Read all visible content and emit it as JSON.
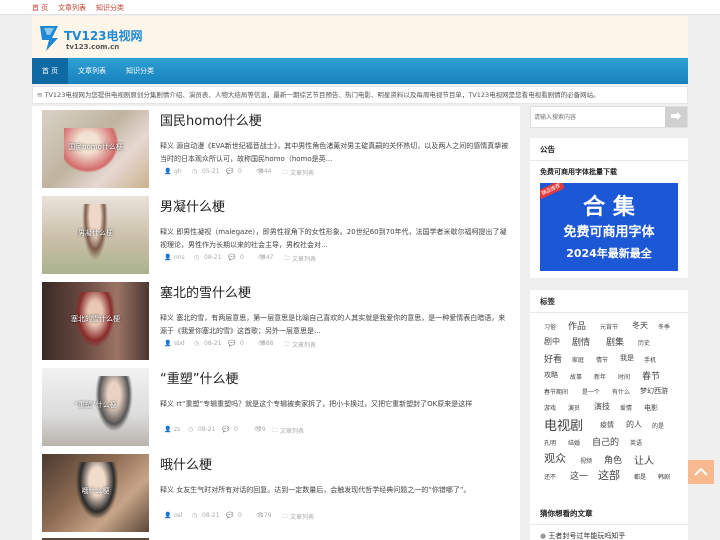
{
  "topnav": [
    "首 页",
    "文章列表",
    "知识分类"
  ],
  "logo": {
    "name": "TV123电视网",
    "domain": "tv123.com.cn"
  },
  "nav": [
    "首 页",
    "文章列表",
    "知识分类"
  ],
  "notice": "TV123电视网为您提供电视剧原创分集剧情介绍、演员表、人物大结局等信息，最新一期综艺节目预告、热门电影、明星资料以及每周电视节目单，TV123电视网是您看电视看剧情的必备网站。",
  "posts": [
    {
      "thumb_caption": "国民homo什么梗",
      "title": "国民homo什么梗",
      "excerpt": "释义 源自动漫《EVA新世纪福音战士》，其中男性角色渚薰对男主碇真嗣的关怀热切，以及两人之间的感情真挚被当时的日本观众所认可，故称国民homo（homo是英...",
      "author": "gh",
      "date": "05-21",
      "comments": "0",
      "views": "844",
      "category": "文章列表"
    },
    {
      "thumb_caption": "男凝什么梗",
      "title": "男凝什么梗",
      "excerpt": "释义 即男性凝视（malegaze），即男性视角下的女性形象。20世纪60到70年代，法国学者米歇尔福柯提出了凝视理论，男性作为长期以来的社会主导，男权社会对...",
      "author": "nns",
      "date": "08-21",
      "comments": "0",
      "views": "447",
      "category": "文章列表"
    },
    {
      "thumb_caption": "塞北的雪什么梗",
      "title": "塞北的雪什么梗",
      "excerpt": "释义 塞北的雪，有两层意思，第一层意思是比喻自己喜欢的人其实就是我爱你的意思，是一种爱情表白暗语，来源于《我爱你塞北的雪》这首歌；另外一层意思是...",
      "author": "sbd",
      "date": "08-21",
      "comments": "0",
      "views": "888",
      "category": "文章列表"
    },
    {
      "thumb_caption": "“重塑”什么梗",
      "title": "“重塑”什么梗",
      "excerpt": "释义 rt“重塑”专辑重塑吗？就是这个专辑被卖家拆了，把小卡换过，又把它重新塑封了OK原来是这样",
      "author": "zs",
      "date": "08-21",
      "comments": "0",
      "views": "79",
      "category": "文章列表"
    },
    {
      "thumb_caption": "哦什么梗",
      "title": "哦什么梗",
      "excerpt": "释义 女友生气时对所有对话的回复。达到一定数量后，会触发现代哲学经典问题之一的“你错哪了”。",
      "author": "osl",
      "date": "08-21",
      "comments": "0",
      "views": "179",
      "category": "文章列表"
    }
  ],
  "sidebar": {
    "search_placeholder": "请输入搜索内容",
    "notice_title": "公告",
    "ad_title": "免费可商用字体批量下载",
    "ad_line1": "合 集",
    "ad_line2": "免费可商用字体",
    "ad_line3": "2024年最新最全",
    "ad_badge": "精品推荐",
    "tags_title": "标签",
    "tags": [
      "习俗",
      "作品",
      "元宵节",
      "冬天",
      "冬季",
      "剧中",
      "剧情",
      "剧集",
      "历史",
      "好看",
      "家庭",
      "情节",
      "我是",
      "手机",
      "攻略",
      "故事",
      "新年",
      "时间",
      "春节",
      "春节期间",
      "是一个",
      "有什么",
      "梦幻西游",
      "游戏",
      "演员",
      "演技",
      "爱情",
      "电影",
      "电视剧",
      "疫情",
      "的人",
      "的是",
      "孔明",
      "结婚",
      "自己的",
      "英语",
      "观众",
      "视频",
      "角色",
      "让人",
      "还不",
      "这一",
      "这部",
      "都是",
      "韩剧"
    ],
    "guess_title": "猜你想看的文章",
    "guess_items": [
      "王者封号过年能玩吗知乎"
    ]
  },
  "colors": {
    "accent": "#1781bd",
    "red": "#c0392b",
    "header_bg": "#fff6ea",
    "ad_bg": "#1c57d6"
  }
}
